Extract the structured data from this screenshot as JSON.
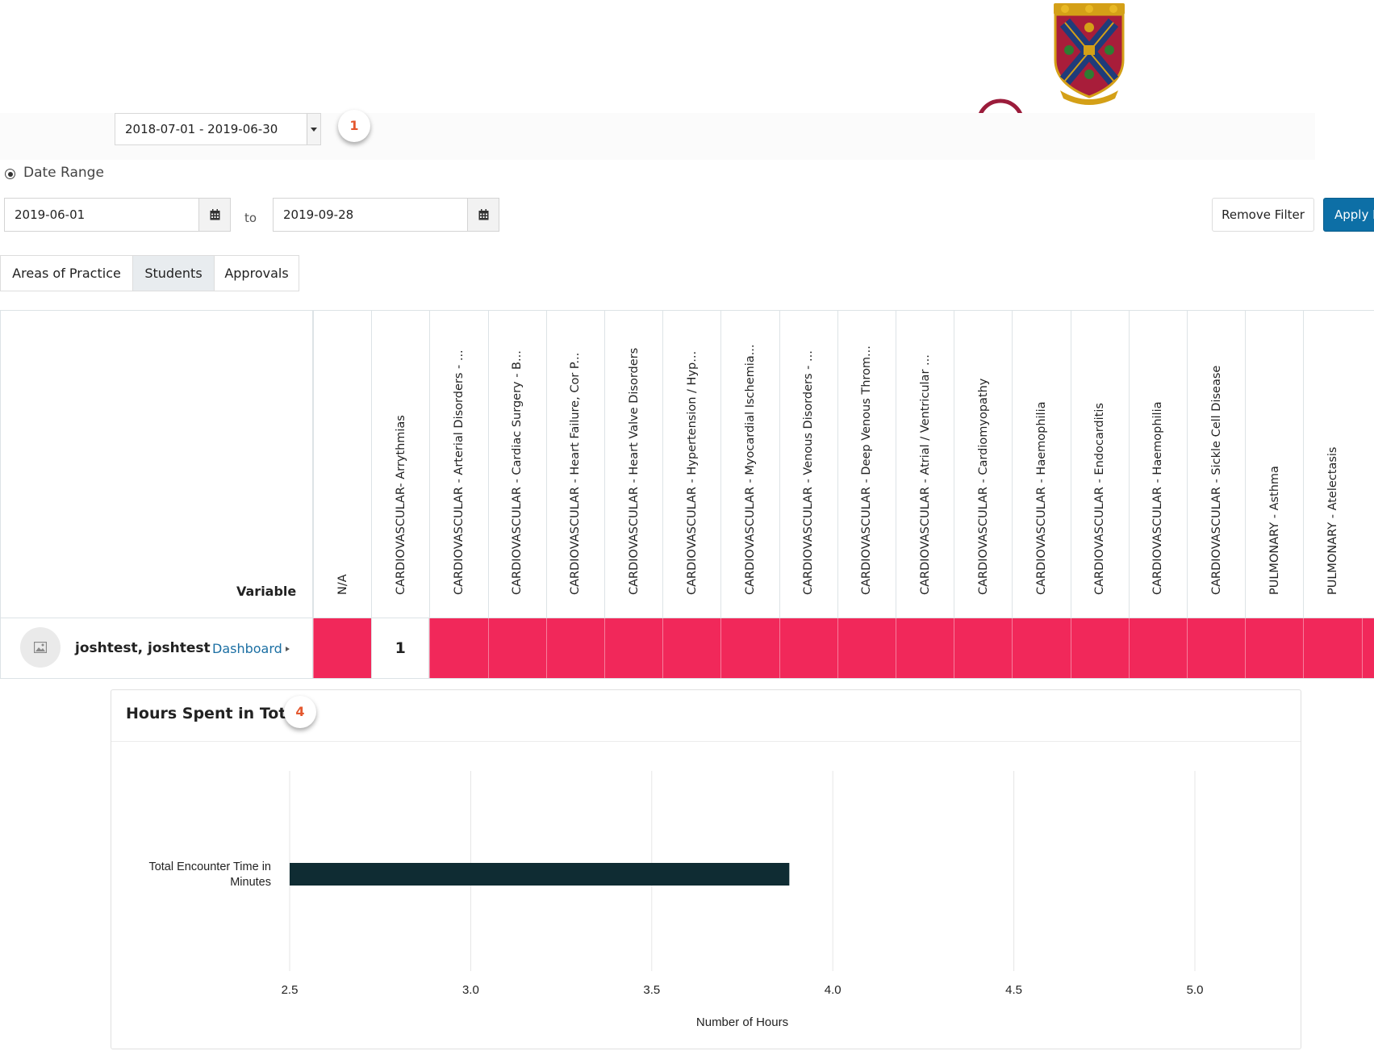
{
  "period_select": {
    "value": "2018-07-01 - 2019-06-30"
  },
  "badges": {
    "period": "1",
    "chart": "4"
  },
  "date_range": {
    "label": "Date Range",
    "start": "2019-06-01",
    "to_label": "to",
    "end": "2019-09-28"
  },
  "filters": {
    "remove_label": "Remove Filter",
    "apply_label": "Apply F"
  },
  "tabs": [
    {
      "label": "Areas of Practice"
    },
    {
      "label": "Students"
    },
    {
      "label": "Approvals"
    }
  ],
  "table": {
    "variable_label": "Variable",
    "columns": [
      "N/A",
      "CARDIOVASCULAR- Arrythmias",
      "CARDIOVASCULAR - Arterial Disorders - ...",
      "CARDIOVASCULAR - Cardiac Surgery - B...",
      "CARDIOVASCULAR - Heart Failure, Cor P...",
      "CARDIOVASCULAR - Heart Valve Disorders",
      "CARDIOVASCULAR - Hypertension / Hyp...",
      "CARDIOVASCULAR - Myocardial Ischemia...",
      "CARDIOVASCULAR - Venous Disorders - ...",
      "CARDIOVASCULAR - Deep Venous Throm...",
      "CARDIOVASCULAR - Atrial / Ventricular ...",
      "CARDIOVASCULAR - Cardiomyopathy",
      "CARDIOVASCULAR - Haemophilia",
      "CARDIOVASCULAR - Endocarditis",
      "CARDIOVASCULAR - Haemophilia",
      "CARDIOVASCULAR - Sickle Cell Disease",
      "PULMONARY - Asthma",
      "PULMONARY - Atelectasis"
    ],
    "row": {
      "student": "joshtest, joshtest",
      "dashboard_label": "Dashboard",
      "cells": [
        "",
        "1",
        "",
        "",
        "",
        "",
        "",
        "",
        "",
        "",
        "",
        "",
        "",
        "",
        "",
        "",
        "",
        "",
        ""
      ]
    },
    "colors": {
      "empty": "#f1285a",
      "filled": "#ffffff"
    }
  },
  "chart": {
    "title": "Hours Spent in Total",
    "color": "#0f2c33"
  },
  "chart_data": {
    "type": "bar",
    "orientation": "horizontal",
    "categories": [
      "Total Encounter Time in Minutes"
    ],
    "values": [
      3.88
    ],
    "xlabel": "Number of Hours",
    "ylabel": "",
    "xlim": [
      2.5,
      5.0
    ],
    "ticks": [
      "2.5",
      "3.0",
      "3.5",
      "4.0",
      "4.5",
      "5.0"
    ],
    "grid": true,
    "legend": "none"
  }
}
